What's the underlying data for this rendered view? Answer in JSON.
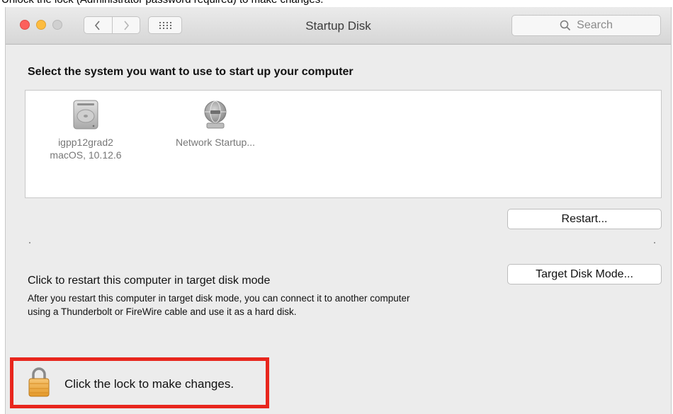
{
  "caption": "Unlock the lock (Administrator password required) to make changes.",
  "window": {
    "title": "Startup Disk",
    "search_placeholder": "Search"
  },
  "main": {
    "heading": "Select the system you want to use to start up your computer",
    "disks": [
      {
        "name": "igpp12grad2",
        "detail": "macOS, 10.12.6",
        "icon": "hard-disk-icon"
      },
      {
        "name": "Network Startup...",
        "detail": "",
        "icon": "network-globe-icon"
      }
    ],
    "restart_label": "Restart...",
    "target_disk": {
      "title": "Click to restart this computer in target disk mode",
      "description": "After you restart this computer in target disk mode, you can connect it to another computer using a Thunderbolt or FireWire cable and use it as a hard disk.",
      "button_label": "Target Disk Mode..."
    }
  },
  "footer": {
    "lock_text": "Click the lock to make changes.",
    "lock_icon": "padlock-icon",
    "highlight_color": "#e8261d"
  }
}
